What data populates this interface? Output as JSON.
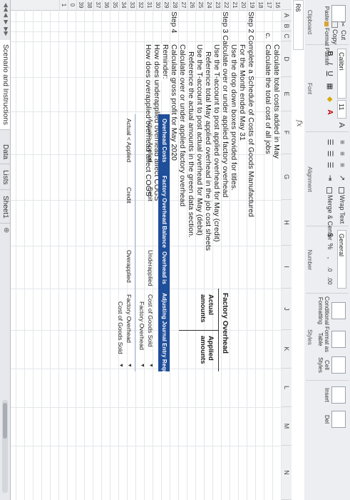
{
  "ribbon": {
    "clipboard": {
      "cut": "Cut",
      "copy": "Copy",
      "paste": "Paste",
      "format_painter": "Format Painter",
      "group_label": "Clipboard"
    },
    "font": {
      "font_name": "Calibri",
      "font_size": "11",
      "bold": "B",
      "italic": "I",
      "underline": "U",
      "grow": "A",
      "shrink": "A",
      "group_label": "Font"
    },
    "alignment": {
      "wrap_text": "Wrap Text",
      "merge_center": "Merge & Center",
      "group_label": "Alignment"
    },
    "number": {
      "format": "General",
      "currency": "$",
      "percent": "%",
      "comma": ",",
      "group_label": "Number"
    },
    "styles": {
      "conditional_formatting": "Conditional Formatting",
      "format_as_table": "Format as Table",
      "cell_styles": "Cell Styles",
      "group_label": "Styles"
    },
    "cells": {
      "insert": "Insert",
      "delete": "Del"
    }
  },
  "formula_bar": {
    "name_box": "R6",
    "fx": "fx",
    "content": ""
  },
  "columns": [
    "A",
    "B",
    "C",
    "D",
    "E",
    "F",
    "G",
    "H",
    "I",
    "J",
    "K",
    "L",
    "M",
    "N"
  ],
  "rows": [
    "16",
    "17",
    "18",
    "19",
    "20",
    "21",
    "22",
    "23",
    "24",
    "25",
    "26",
    "27",
    "28",
    "29",
    "30",
    "31",
    "32",
    "33",
    "34",
    "35",
    "36",
    "37",
    "38",
    "39",
    "0",
    "1"
  ],
  "sheet_text": {
    "r16": "Calculate total costs added in May",
    "r17_label": "c.",
    "r17": "Calculate the total cost of all jobs",
    "r19": "Step 2 Complete a Schedule of Costs of Goods Manufactured",
    "r20": "For the Month ended May 31",
    "r21": "Use the drop down boxes provided for titles.",
    "r22": "Step 3 Calculate over or under applied factory overhead",
    "r23": "Use the T-account to post applied overhead for May (credit)",
    "r24": "Reference total May applied overhead in the job cost sheets",
    "r25": "Use the T-account to post actual overhead for May (debit)",
    "r26": "Reference the actual amounts in the green data section.",
    "r27": "Calculate over or under applied factory overhead",
    "r28_label": "Step 4",
    "r28": "Calculate gross profit for May 2020",
    "r29": "Reminder:",
    "r30": "How does underapplied overhead affect COGS",
    "r31": "How does overapplied overhead affect COGS"
  },
  "t_account": {
    "title": "Factory Overhead",
    "debit_line1": "Actual",
    "debit_line2": "amounts",
    "credit_line1": "Applied",
    "credit_line2": "amounts"
  },
  "overhead_table": {
    "headers": [
      "Overhead Costs",
      "Factory Overhead Balance",
      "Overhead is",
      "Adjusting Journal Entry Required"
    ],
    "rows": [
      {
        "costs": "Actual > Applied",
        "balance": "Debit",
        "overhead_is": "Underapplied",
        "entry1": "Cost of Goods Sold",
        "entry2": "Factory Overhead"
      },
      {
        "costs": "Actual < Applied",
        "balance": "Credit",
        "overhead_is": "Overapplied",
        "entry1": "Factory Overhead",
        "entry2": "Cost of Goods Sold"
      }
    ],
    "dropdown_glyph": "▼"
  },
  "sheet_tabs": {
    "nav": [
      "◀◀",
      "◀",
      "▶",
      "▶▶"
    ],
    "tabs": [
      "Scenario and Instructions",
      "Data",
      "Lists",
      "Sheet1"
    ],
    "active_index": 0,
    "add_glyph": "⊕"
  }
}
